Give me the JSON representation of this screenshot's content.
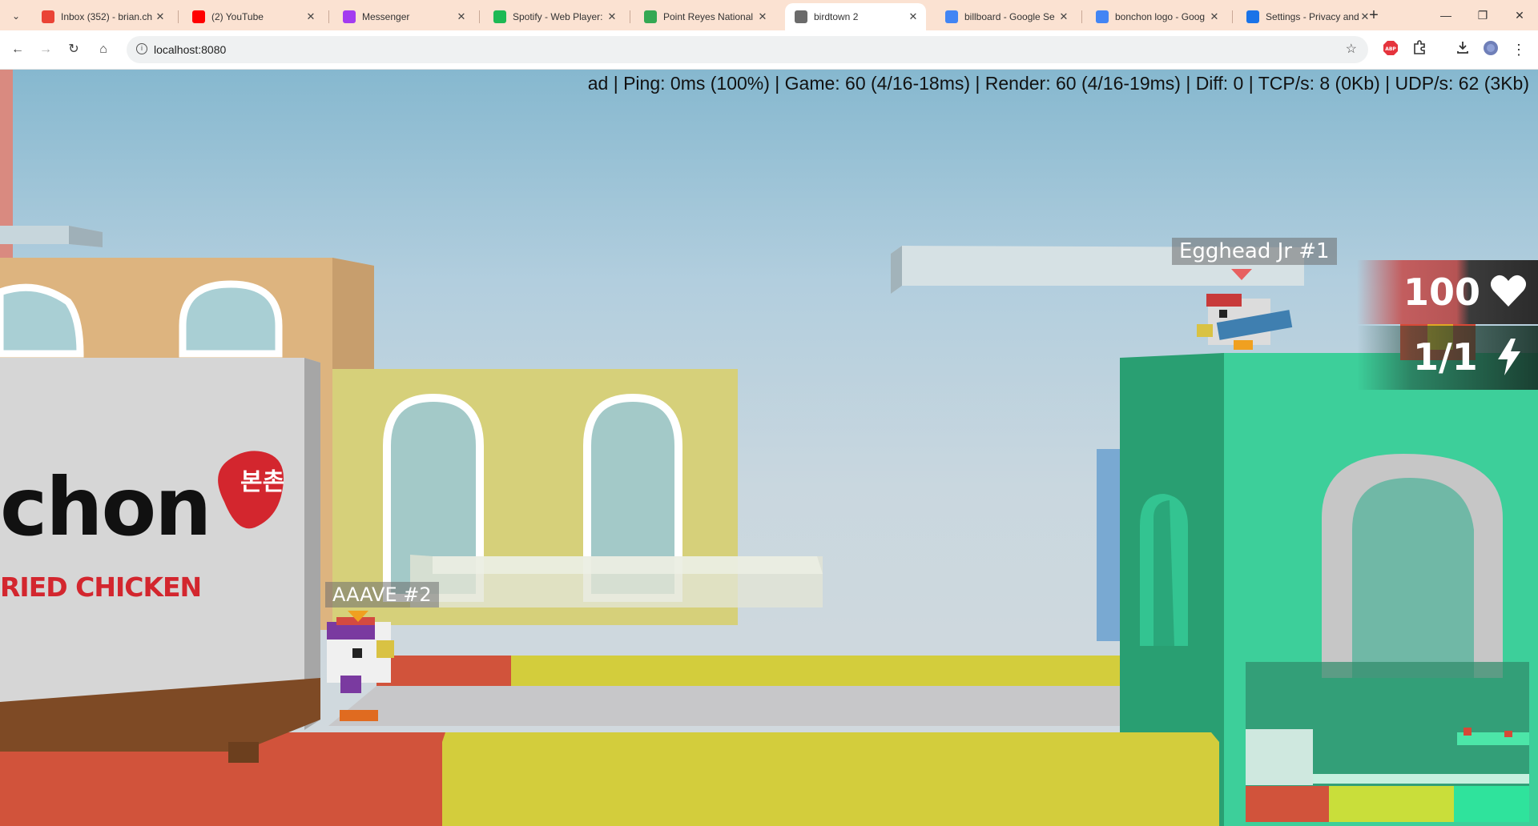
{
  "browser": {
    "tabs": [
      {
        "title": "Inbox (352) - brian.ch",
        "icon": "gmail-icon",
        "color": "#ea4335"
      },
      {
        "title": "(2) YouTube",
        "icon": "youtube-icon",
        "color": "#ff0000"
      },
      {
        "title": "Messenger",
        "icon": "messenger-icon",
        "color": "#a33bf0"
      },
      {
        "title": "Spotify - Web Player:",
        "icon": "spotify-icon",
        "color": "#1db954"
      },
      {
        "title": "Point Reyes National",
        "icon": "maps-pin-icon",
        "color": "#34a853"
      },
      {
        "title": "birdtown 2",
        "icon": "birdtown-icon",
        "color": "#6b6b6b"
      },
      {
        "title": "billboard - Google Se",
        "icon": "google-icon",
        "color": "#4285f4"
      },
      {
        "title": "bonchon logo - Goog",
        "icon": "google-icon",
        "color": "#4285f4"
      },
      {
        "title": "Settings - Privacy and",
        "icon": "settings-gear-icon",
        "color": "#1a73e8"
      }
    ],
    "active_tab_index": 5,
    "url": "localhost:8080"
  },
  "game": {
    "debug": "ad | Ping: 0ms (100%) | Game: 60 (4/16-18ms) | Render: 60 (4/16-19ms) | Diff: 0 | TCP/s: 8 (0Kb) | UDP/s: 62 (3Kb)",
    "players": [
      {
        "name": "Egghead Jr #1",
        "marker_color": "#e76060"
      },
      {
        "name": "AAAVE #2",
        "marker_color": "#f0a020"
      }
    ],
    "hud": {
      "health": "100",
      "ammo": "1/1"
    },
    "billboard": {
      "brand": "chon",
      "subtitle": "RIED CHICKEN",
      "logo_text": "본촌"
    },
    "colors": {
      "sky_top": "#86b8cf",
      "green_building": "#3dcf9a",
      "yellow_block": "#d3cd3c",
      "red_floor": "#d1533b"
    }
  }
}
